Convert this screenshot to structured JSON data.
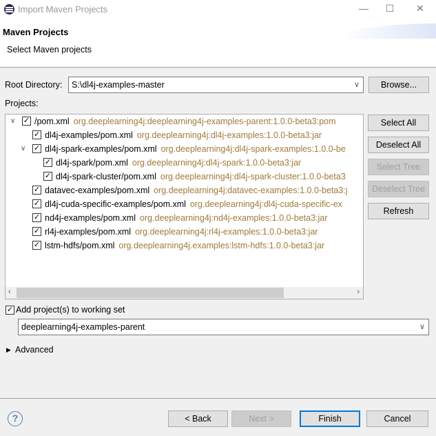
{
  "window": {
    "title": "Import Maven Projects",
    "minimize": "—",
    "maximize": "☐",
    "close": "✕"
  },
  "header": {
    "title": "Maven Projects",
    "subtitle": "Select Maven projects"
  },
  "root": {
    "label": "Root Directory:",
    "value": "S:\\dl4j-examples-master",
    "browse": "Browse..."
  },
  "projects_label": "Projects:",
  "tree": [
    {
      "level": 0,
      "expandable": true,
      "checked": true,
      "name": "/pom.xml",
      "coord": "org.deeplearning4j:deeplearning4j-examples-parent:1.0.0-beta3:pom"
    },
    {
      "level": 1,
      "expandable": false,
      "checked": true,
      "name": "dl4j-examples/pom.xml",
      "coord": "org.deeplearning4j:dl4j-examples:1.0.0-beta3:jar"
    },
    {
      "level": 1,
      "expandable": true,
      "checked": true,
      "name": "dl4j-spark-examples/pom.xml",
      "coord": "org.deeplearning4j:dl4j-spark-examples:1.0.0-be"
    },
    {
      "level": 2,
      "expandable": false,
      "checked": true,
      "name": "dl4j-spark/pom.xml",
      "coord": "org.deeplearning4j:dl4j-spark:1.0.0-beta3:jar"
    },
    {
      "level": 2,
      "expandable": false,
      "checked": true,
      "name": "dl4j-spark-cluster/pom.xml",
      "coord": "org.deeplearning4j:dl4j-spark-cluster:1.0.0-beta3"
    },
    {
      "level": 1,
      "expandable": false,
      "checked": true,
      "name": "datavec-examples/pom.xml",
      "coord": "org.deeplearning4j:datavec-examples:1.0.0-beta3:j"
    },
    {
      "level": 1,
      "expandable": false,
      "checked": true,
      "name": "dl4j-cuda-specific-examples/pom.xml",
      "coord": "org.deeplearning4j:dl4j-cuda-specific-ex"
    },
    {
      "level": 1,
      "expandable": false,
      "checked": true,
      "name": "nd4j-examples/pom.xml",
      "coord": "org.deeplearning4j:nd4j-examples:1.0.0-beta3:jar"
    },
    {
      "level": 1,
      "expandable": false,
      "checked": true,
      "name": "rl4j-examples/pom.xml",
      "coord": "org.deeplearning4j:rl4j-examples:1.0.0-beta3:jar"
    },
    {
      "level": 1,
      "expandable": false,
      "checked": true,
      "name": "lstm-hdfs/pom.xml",
      "coord": "org.deeplearning4j.examples:lstm-hdfs:1.0.0-beta3:jar"
    }
  ],
  "side_buttons": [
    {
      "label": "Select All",
      "enabled": true
    },
    {
      "label": "Deselect All",
      "enabled": true
    },
    {
      "label": "Select Tree",
      "enabled": false
    },
    {
      "label": "Deselect Tree",
      "enabled": false
    },
    {
      "label": "Refresh",
      "enabled": true
    }
  ],
  "working_set": {
    "label": "Add project(s) to working set",
    "checked": true,
    "value": "deeplearning4j-examples-parent"
  },
  "advanced": "Advanced",
  "footer": {
    "back": "< Back",
    "next": "Next >",
    "finish": "Finish",
    "cancel": "Cancel",
    "help": "?"
  },
  "colors": {
    "coordinate_text": "#a07a3a",
    "default_button_border": "#0078d7"
  }
}
